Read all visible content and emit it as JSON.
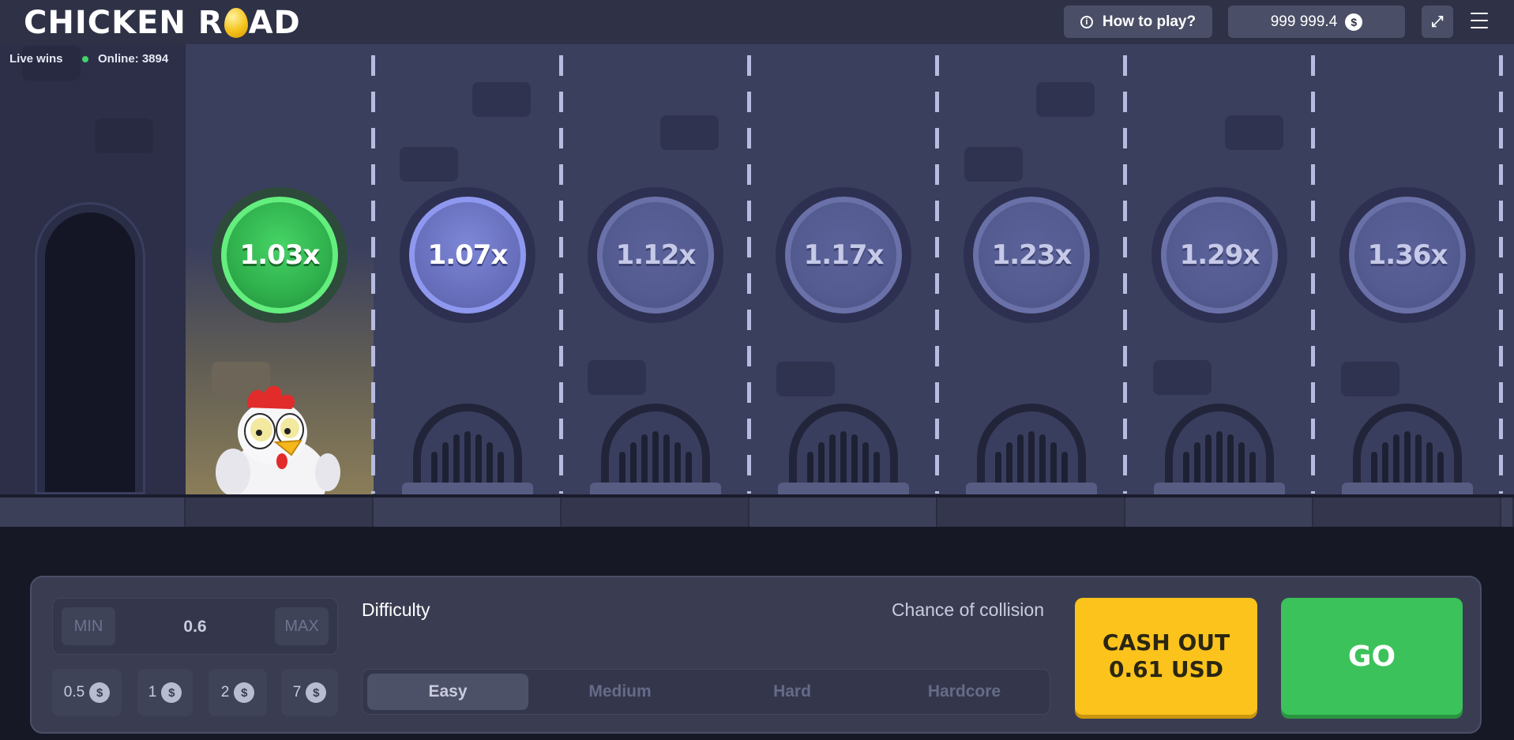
{
  "header": {
    "logo_left": "CHICKEN R",
    "logo_right": "AD",
    "how_to_play_label": "How to play?",
    "info_icon": "i",
    "balance": "999 999.4",
    "currency_icon": "$",
    "fullscreen_icon": "⤢"
  },
  "live": {
    "live_wins_label": "Live wins",
    "online_label": "Online: 3894"
  },
  "lanes": {
    "multipliers": [
      "1.03x",
      "1.07x",
      "1.12x",
      "1.17x",
      "1.23x",
      "1.29x",
      "1.36x"
    ],
    "current_index": 0,
    "next_index": 1
  },
  "bet": {
    "min_label": "MIN",
    "max_label": "MAX",
    "value": "0.6",
    "currency_icon": "$",
    "quick_amounts": [
      "0.5",
      "1",
      "2",
      "7"
    ]
  },
  "difficulty": {
    "label": "Difficulty",
    "chance_label": "Chance of collision",
    "options": [
      "Easy",
      "Medium",
      "Hard",
      "Hardcore"
    ],
    "selected": "Easy"
  },
  "cashout": {
    "line1": "CASH OUT",
    "line2": "0.61 USD"
  },
  "go": {
    "label": "GO"
  },
  "colors": {
    "cashout": "#fbc31c",
    "go": "#3cc25a",
    "active_coin": "#2fb04c",
    "scene": "#3b3f5e"
  }
}
